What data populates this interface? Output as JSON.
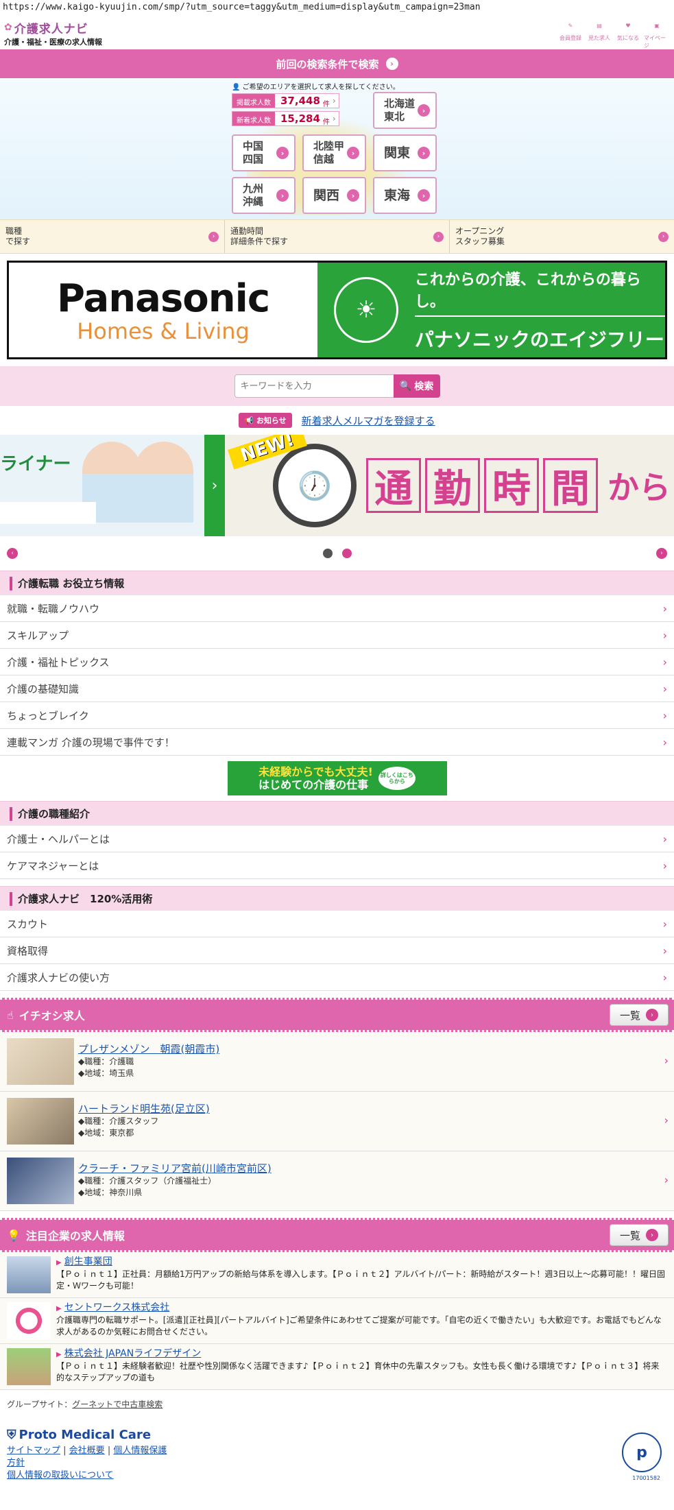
{
  "browser": {
    "url": "https://www.kaigo-kyuujin.com/smp/?utm_source=taggy&utm_medium=display&utm_campaign=23man"
  },
  "header": {
    "logo_name": "介護求人ナビ",
    "logo_sub": "介護・福祉・医療の求人情報",
    "icons": [
      {
        "label": "会員登録",
        "icon": "pencil-icon"
      },
      {
        "label": "見た求人",
        "icon": "history-icon"
      },
      {
        "label": "気になる",
        "icon": "heart-icon"
      },
      {
        "label": "マイページ",
        "icon": "mypage-icon"
      }
    ]
  },
  "prev_search": {
    "label": "前回の検索条件で検索"
  },
  "area": {
    "caption": "ご希望のエリアを選択して求人を探してください。",
    "stats": [
      {
        "label": "掲載求人数",
        "value": "37,448",
        "unit": "件"
      },
      {
        "label": "新着求人数",
        "value": "15,284",
        "unit": "件"
      }
    ],
    "regions": {
      "hokkaido": "北海道東北",
      "chugoku": "中国四国",
      "hokuriku": "北陸甲信越",
      "kanto": "関東",
      "kyushu": "九州沖縄",
      "kansai": "関西",
      "tokai": "東海"
    }
  },
  "search_options": [
    {
      "line1": "職種",
      "line2": "で探す"
    },
    {
      "line1": "通勤時間",
      "line2": "詳細条件で探す"
    },
    {
      "line1": "オープニング",
      "line2": "スタッフ募集"
    }
  ],
  "ad_banner": {
    "brand": "Panasonic",
    "sub": "Homes & Living",
    "tagline": "これからの介護、これからの暮らし。",
    "product": "パナソニックのエイジフリー"
  },
  "keyword": {
    "placeholder": "キーワードを入力",
    "button": "検索"
  },
  "notice": {
    "badge": "お知らせ",
    "link": "新着求人メルマガを登録する"
  },
  "carousel": {
    "slideA_text": "ライナー",
    "new_tag": "NEW!",
    "kanji": [
      "通",
      "勤",
      "時",
      "間"
    ],
    "kara": "から"
  },
  "useful_info": {
    "title": "介護転職 お役立ち情報",
    "items": [
      "就職・転職ノウハウ",
      "スキルアップ",
      "介護・福祉トピックス",
      "介護の基礎知識",
      "ちょっとブレイク",
      "連載マンガ 介護の現場で事件です！"
    ]
  },
  "promo": {
    "line1": "未経験からでも大丈夫!",
    "line2": "はじめての介護の仕事",
    "badge": "詳しくはこちらから"
  },
  "job_types": {
    "title": "介護の職種紹介",
    "items": [
      "介護士・ヘルパーとは",
      "ケアマネジャーとは"
    ]
  },
  "navi120": {
    "title": "介護求人ナビ　120%活用術",
    "items": [
      "スカウト",
      "資格取得",
      "介護求人ナビの使い方"
    ]
  },
  "recommended": {
    "title": "イチオシ求人",
    "button": "一覧",
    "jobs": [
      {
        "name": "プレザンメゾン　朝霞(朝霞市)",
        "type": "◆職種：介護職",
        "area": "◆地域：埼玉県"
      },
      {
        "name": "ハートランド明生苑(足立区)",
        "type": "◆職種：介護スタッフ",
        "area": "◆地域：東京都"
      },
      {
        "name": "クラーチ・ファミリア宮前(川崎市宮前区)",
        "type": "◆職種：介護スタッフ（介護福祉士）",
        "area": "◆地域：神奈川県"
      }
    ]
  },
  "featured": {
    "title": "注目企業の求人情報",
    "button": "一覧",
    "companies": [
      {
        "name": "創生事業団",
        "desc": "【Ｐｏｉｎｔ１】正社員：月額給1万円アップの新給与体系を導入します。【Ｐｏｉｎｔ２】アルバイト/パート：新時給がスタート！週3日以上〜応募可能！！曜日固定・Ｗワークも可能！"
      },
      {
        "name": "セントワークス株式会社",
        "desc": "介護職専門の転職サポート。[派遣][正社員][パートアルバイト]ご希望条件にあわせてご提案が可能です。「自宅の近くで働きたい」も大歓迎です。お電話でもどんな求人があるのか気軽にお問合せください。"
      },
      {
        "name": "株式会社 JAPANライフデザイン",
        "desc": "【Ｐｏｉｎｔ１】未経験者歓迎！社歴や性別関係なく活躍できます♪【Ｐｏｉｎｔ２】育休中の先輩スタッフも。女性も長く働ける環境です♪【Ｐｏｉｎｔ３】将来的なステップアップの道も"
      }
    ]
  },
  "footer": {
    "group_label": "グループサイト：",
    "group_link": "グーネットで中古車検索",
    "company": "Proto Medical Care",
    "links": [
      "サイトマップ",
      "会社概要",
      "個人情報保護",
      "方針",
      "個人情報の取扱いについて"
    ],
    "pmark_no": "17001582"
  },
  "colors": {
    "accent": "#df66ac",
    "accent_dark": "#d4418f",
    "green": "#27a33a"
  }
}
